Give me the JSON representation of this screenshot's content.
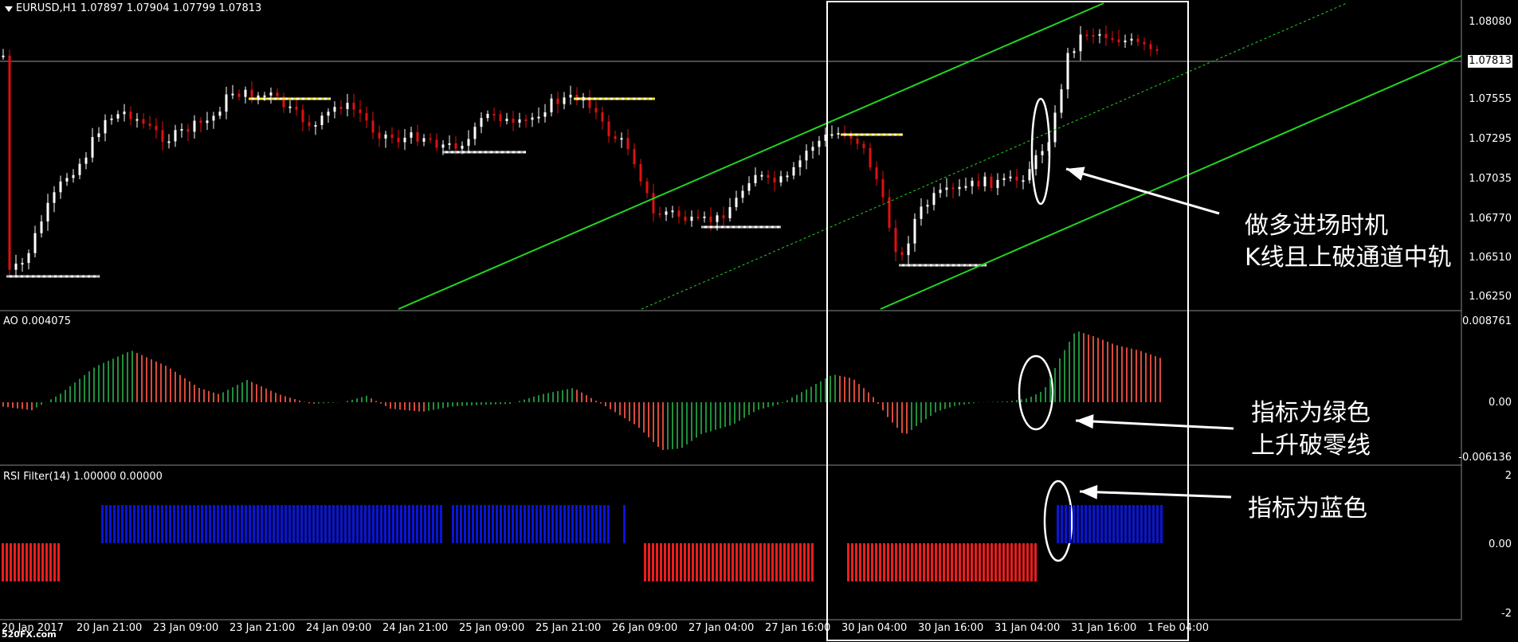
{
  "main_title": "EURUSD,H1  1.07897 1.07904 1.07799 1.07813",
  "ao_title": "AO 0.004075",
  "rsi_title": "RSI Filter(14) 1.00000 0.00000",
  "current_price": "1.07813",
  "price_axis": [
    "1.08080",
    "1.07555",
    "1.07295",
    "1.07035",
    "1.06770",
    "1.06510",
    "1.06250"
  ],
  "ao_axis": [
    "0.008761",
    "0.00",
    "-0.006136"
  ],
  "rsi_axis": [
    "2",
    "0.00",
    "-2"
  ],
  "time_axis": [
    "20 Jan 2017",
    "20 Jan 21:00",
    "23 Jan 09:00",
    "23 Jan 21:00",
    "24 Jan 09:00",
    "24 Jan 21:00",
    "25 Jan 09:00",
    "25 Jan 21:00",
    "26 Jan 09:00",
    "27 Jan 04:00",
    "27 Jan 16:00",
    "30 Jan 04:00",
    "30 Jan 16:00",
    "31 Jan 04:00",
    "31 Jan 16:00",
    "1 Feb 04:00"
  ],
  "annotations": {
    "main_line1": "做多进场时机",
    "main_line2": "K线且上破通道中轨",
    "ao_line1": "指标为绿色",
    "ao_line2": "上升破零线",
    "rsi_line1": "指标为蓝色"
  },
  "watermark": "520FX.com",
  "colors": {
    "background": "#000000",
    "bull_candle": "#ffffff",
    "bear_candle": "#e01010",
    "channel": "#22d422",
    "resistance": "#f2e635",
    "ao_up": "#1f8f3a",
    "ao_down": "#d94a3a",
    "rsi_bull": "#0a14d8",
    "rsi_bear": "#ee1c1c"
  }
}
